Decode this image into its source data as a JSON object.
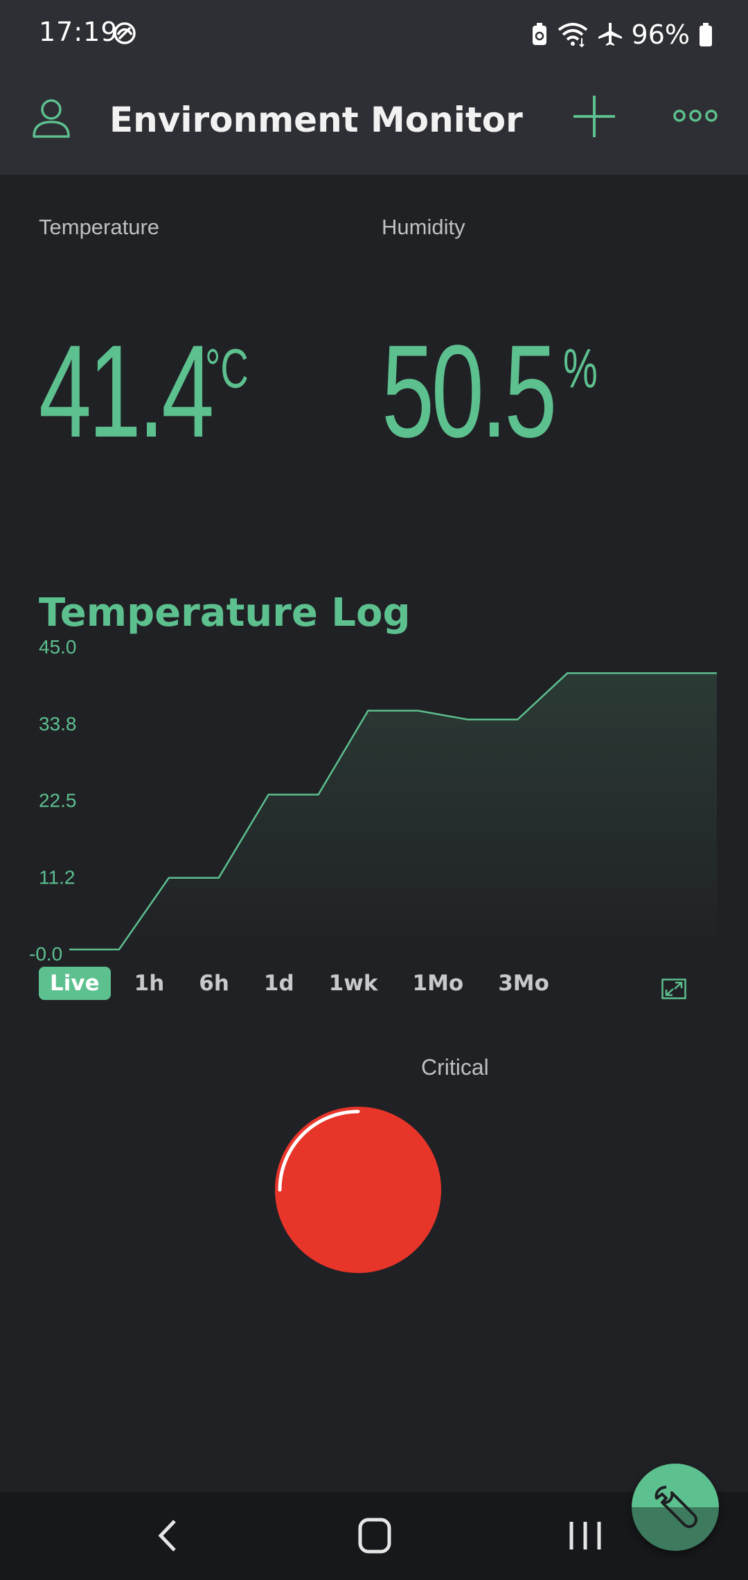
{
  "status_bar": {
    "time": "17:19",
    "battery": "96%",
    "icons": [
      "sync-icon",
      "battery-saver-icon",
      "wifi-icon",
      "airplane-icon",
      "battery-icon"
    ]
  },
  "app_bar": {
    "title": "Environment Monitor",
    "icons": [
      "user-icon",
      "plus-icon",
      "more-icon"
    ]
  },
  "widgets": {
    "temperature": {
      "label": "Temperature",
      "value": "41.4",
      "unit": "°C"
    },
    "humidity": {
      "label": "Humidity",
      "value": "50.5",
      "unit": "%"
    }
  },
  "chart": {
    "title": "Temperature Log",
    "ranges": [
      "Live",
      "1h",
      "6h",
      "1d",
      "1wk",
      "1Mo",
      "3Mo"
    ],
    "active_range": "Live"
  },
  "chart_data": {
    "type": "area",
    "title": "Temperature Log",
    "yticks": [
      "45.0",
      "33.8",
      "22.5",
      "11.2",
      "-0.0"
    ],
    "ylim": [
      0,
      45
    ],
    "x": [
      0,
      1,
      2,
      3,
      4,
      5,
      6,
      7,
      8,
      9,
      10,
      11,
      12,
      13
    ],
    "series": [
      {
        "values": [
          0.5,
          0.5,
          11,
          11,
          23.2,
          23.2,
          35.5,
          35.5,
          34.2,
          34.2,
          41,
          41,
          41,
          41
        ]
      }
    ],
    "grid": false,
    "line_color": "#5dc08f"
  },
  "led": {
    "label": "Critical",
    "color": "#e8352a"
  },
  "colors": {
    "accent": "#5dc08f",
    "background": "#202125",
    "bar": "#2e2f34",
    "led_red": "#e8352a"
  }
}
